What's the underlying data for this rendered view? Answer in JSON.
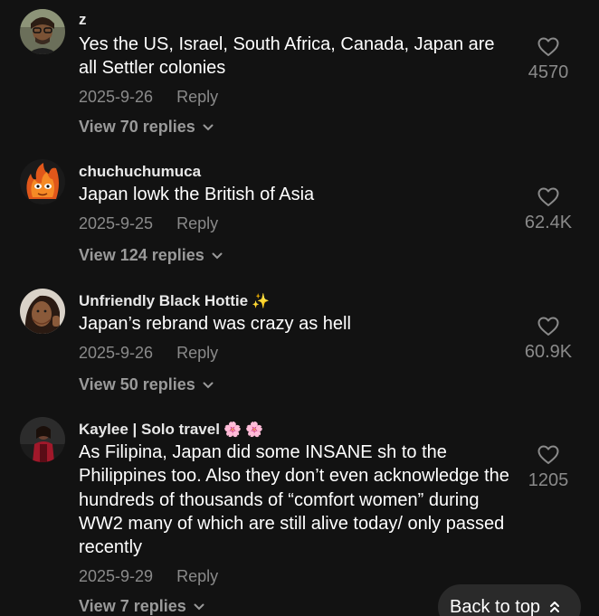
{
  "comments": [
    {
      "username": "z",
      "emoji": "",
      "text": "Yes the US, Israel, South Africa, Canada, Japan are all Settler colonies",
      "date": "2025-9-26",
      "reply_label": "Reply",
      "view_replies": "View 70 replies",
      "likes": "4570",
      "avatar": "man-with-glasses-avatar"
    },
    {
      "username": "chuchuchumuca",
      "emoji": "",
      "text": "Japan lowk the British of Asia",
      "date": "2025-9-25",
      "reply_label": "Reply",
      "view_replies": "View 124 replies",
      "likes": "62.4K",
      "avatar": "fire-cat-avatar"
    },
    {
      "username": "Unfriendly Black Hottie",
      "emoji": "✨",
      "text": "Japan’s rebrand was crazy as hell",
      "date": "2025-9-26",
      "reply_label": "Reply",
      "view_replies": "View 50 replies",
      "likes": "60.9K",
      "avatar": "woman-selfie-avatar"
    },
    {
      "username": "Kaylee | Solo travel",
      "emoji": "🌸 🌸",
      "text": "As Filipina, Japan did some INSANE sh to the Philippines too. Also they don’t even acknowledge the hundreds of thousands of “comfort women” during WW2 many of which are still alive today/ only passed recently",
      "date": "2025-9-29",
      "reply_label": "Reply",
      "view_replies": "View 7 replies",
      "likes": "1205",
      "avatar": "woman-red-jacket-avatar"
    }
  ],
  "back_to_top": "Back to top",
  "icons": {
    "like": "heart-outline-icon",
    "expand": "chevron-down-icon",
    "back_to_top": "double-chevron-up-icon"
  }
}
